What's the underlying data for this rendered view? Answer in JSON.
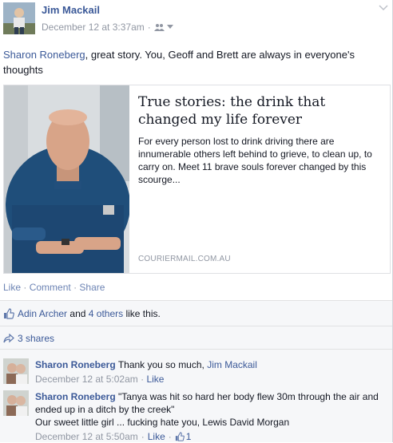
{
  "post": {
    "author": "Jim Mackail",
    "timestamp": "December 12 at 3:37am",
    "audience_icon": "friends-icon",
    "text_mention": "Sharon Roneberg",
    "text_body": ", great story. You, Geoff and Brett are always in everyone's thoughts"
  },
  "link_card": {
    "title": "True stories: the drink that changed my life forever",
    "description": "For every person lost to drink driving there are innumerable others left behind to grieve, to clean up, to carry on. Meet 11 brave souls forever changed by this scourge...",
    "source": "COURIERMAIL.COM.AU"
  },
  "actions": {
    "like": "Like",
    "comment": "Comment",
    "share": "Share",
    "separator": "·"
  },
  "likes": {
    "person": "Adin Archer",
    "and": "and",
    "others": "4 others",
    "suffix": "like this."
  },
  "shares": {
    "label": "3 shares"
  },
  "comments": [
    {
      "author": "Sharon Roneberg",
      "text": "Thank you so much,",
      "mention": "Jim Mackail",
      "timestamp": "December 12 at 5:02am",
      "like": "Like"
    },
    {
      "author": "Sharon Roneberg",
      "text": "\"Tanya was hit so hard her body flew 30m through the air and ended up in a ditch by the creek\"",
      "text2": "Our sweet little girl ... fucking hate you, Lewis David Morgan",
      "timestamp": "December 12 at 5:50am",
      "like": "Like",
      "like_count": "1"
    }
  ],
  "colors": {
    "link": "#3b5998",
    "meta": "#9197a3",
    "panel": "#f6f7f9"
  }
}
